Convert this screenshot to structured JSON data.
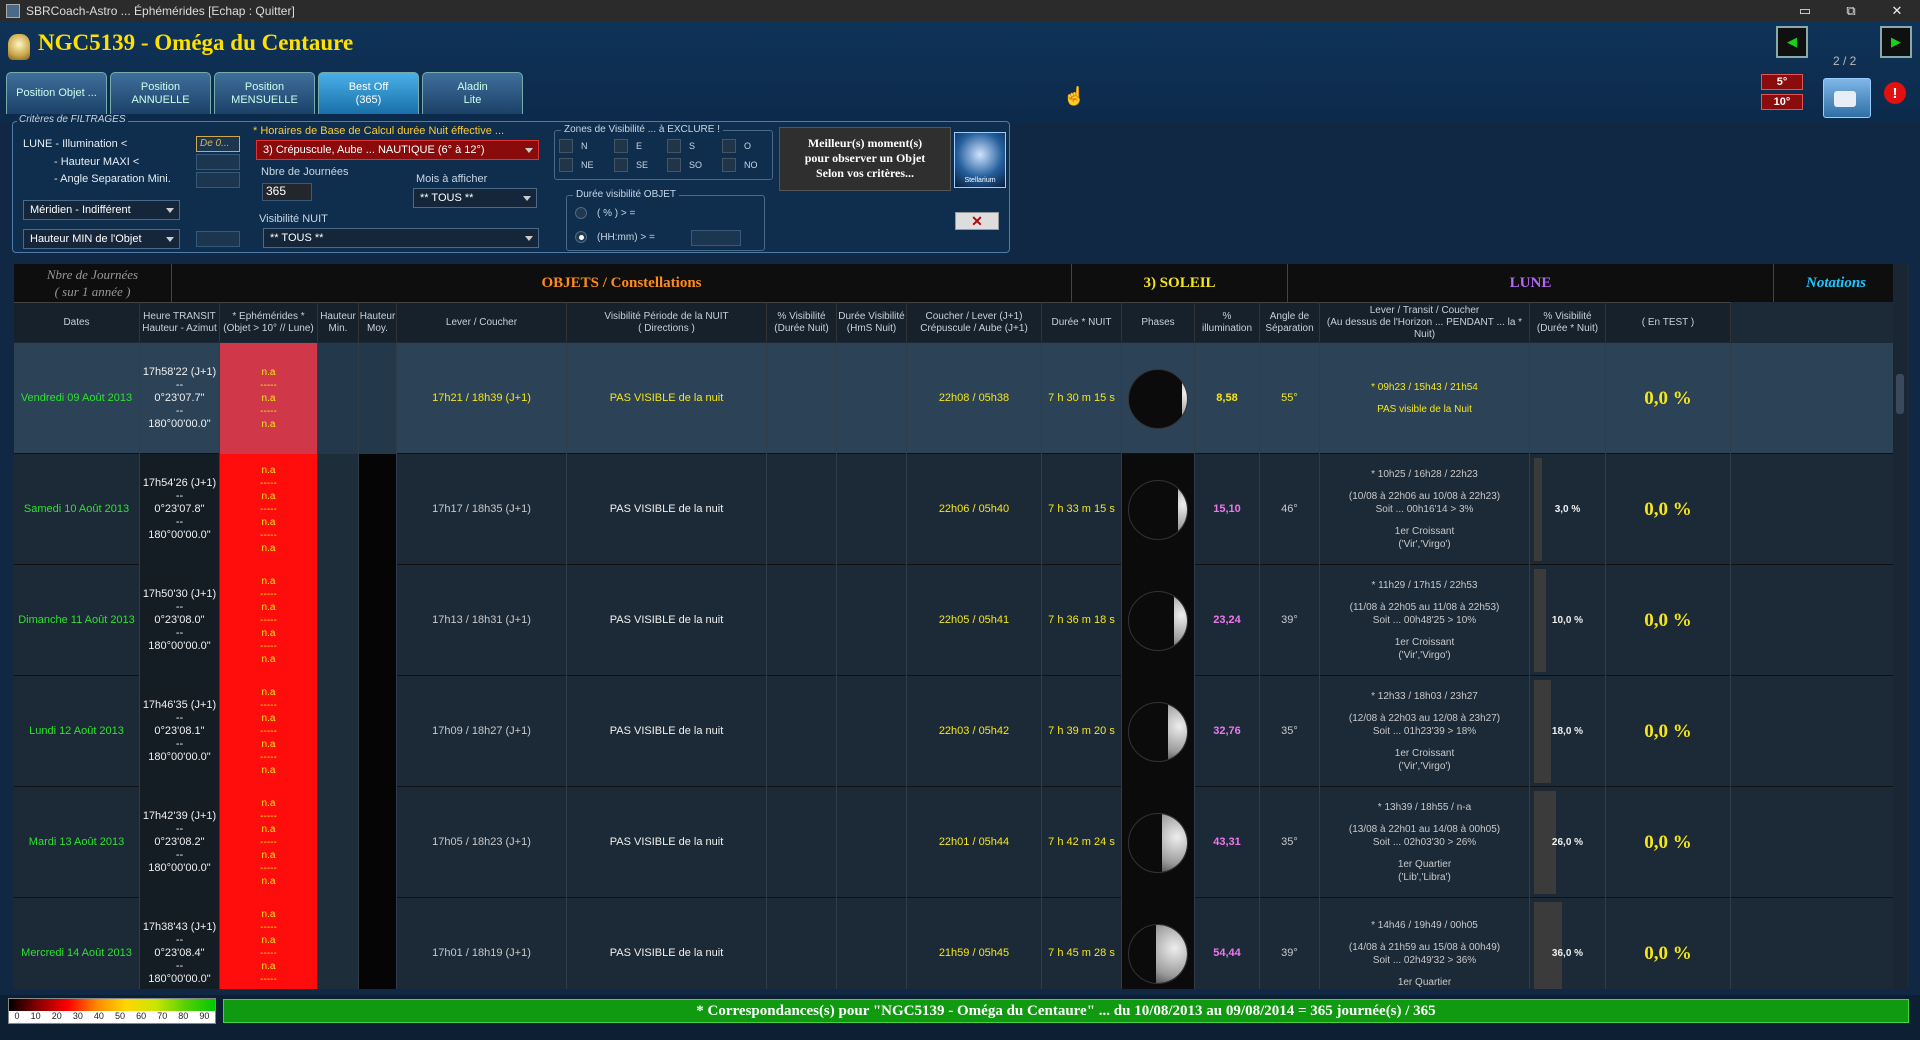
{
  "window": {
    "title": "SBRCoach-Astro ... Éphémérides   [Echap : Quitter]",
    "controls": [
      "▭",
      "⧉",
      "✕"
    ]
  },
  "header": {
    "object_title": "NGC5139 - Oméga du Centaure",
    "prev_arrow": "◀",
    "next_arrow": "▶",
    "page": "2 / 2",
    "deg_options": [
      "5°",
      "10°"
    ],
    "alert": "!"
  },
  "tabs": [
    {
      "line1": "Position Objet ...",
      "line2": "",
      "active": false
    },
    {
      "line1": "Position",
      "line2": "ANNUELLE",
      "active": false
    },
    {
      "line1": "Position",
      "line2": "MENSUELLE",
      "active": false
    },
    {
      "line1": "Best Off",
      "line2": "(365)",
      "active": true
    },
    {
      "line1": "Aladin",
      "line2": "Lite",
      "active": false
    }
  ],
  "filters": {
    "legend": "Critères de FILTRAGES",
    "lune_illum": "LUNE - Illumination <",
    "hauteur_maxi": "- Hauteur MAXI <",
    "angle_sep": "- Angle Separation Mini.",
    "de_placeholder": "De 0...",
    "meridien": "Méridien - Indifférent",
    "hauteur_min": "Hauteur MIN de l'Objet",
    "horaires_label": "* Horaires de Base de Calcul durée Nuit éffective ...",
    "horaires_value": "3) Crépuscule, Aube ... NAUTIQUE (6° à 12°)",
    "nbre_journees_label": "Nbre de Journées",
    "nbre_journees_value": "365",
    "mois_label": "Mois à afficher",
    "mois_value": "** TOUS **",
    "visibilite_label": "Visibilité NUIT",
    "visibilite_value": "** TOUS **",
    "zones_label": "Zones de Visibilité ... à EXCLURE !",
    "zones": [
      "N",
      "E",
      "S",
      "O",
      "NE",
      "SE",
      "SO",
      "NO"
    ],
    "duree_label": "Durée visibilité OBJET",
    "duree_opt1": "( % ) > =",
    "duree_opt2": "(HH:mm) > =",
    "best_btn": [
      "Meilleur(s) moment(s)",
      "pour observer un Objet",
      "Selon vos critères..."
    ],
    "stellarium": "Stellarium",
    "close": "✕"
  },
  "grid": {
    "group_headers": {
      "journees": "Nbre de Journées\n( sur 1 année )",
      "objets": "OBJETS / Constellations",
      "soleil": "3) SOLEIL",
      "lune": "LUNE",
      "notations": "Notations"
    },
    "columns": [
      "Dates",
      "Heure TRANSIT\nHauteur - Azimut",
      "* Ephémérides *\n(Objet > 10° // Lune)",
      "Hauteur\nMin.",
      "Hauteur\nMoy.",
      "Lever / Coucher",
      "Visibilité Période de la NUIT\n( Directions )",
      "% Visibilité\n(Durée Nuit)",
      "Durée Visibilité\n(HmS Nuit)",
      "Coucher / Lever (J+1)\nCrépuscule / Aube (J+1)",
      "Durée * NUIT",
      "Phases",
      "%\nillumination",
      "Angle de\nSéparation",
      "Lever / Transit / Coucher\n(Au dessus de l'Horizon ... PENDANT ... la * Nuit)",
      "% Visibilité\n(Durée * Nuit)",
      "( En TEST )"
    ],
    "rows": [
      {
        "date": "Vendredi 09 Août 2013",
        "transit": [
          "17h58'22 (J+1)",
          "--",
          "0°23'07.7\"",
          "--",
          "180°00'00.0\""
        ],
        "ephem": [
          "n.a",
          "-----",
          "n.a",
          "-----",
          "n.a"
        ],
        "lever_coucher": "17h21 / 18h39 (J+1)",
        "visibilite": "PAS VISIBLE de la nuit",
        "soleil": "22h08 / 05h38",
        "duree_nuit": "7 h 30 m 15 s",
        "phase": 0.08,
        "illum": "8,58",
        "angle": "55°",
        "lune": [
          "* 09h23 / 15h43 / 21h54",
          "",
          "PAS visible de la Nuit"
        ],
        "vis_pct": "",
        "vis_frac": 0,
        "note": "0,0 %"
      },
      {
        "date": "Samedi 10 Août 2013",
        "transit": [
          "17h54'26 (J+1)",
          "--",
          "0°23'07.8\"",
          "--",
          "180°00'00.0\""
        ],
        "ephem": [
          "n.a",
          "-----",
          "n.a",
          "-----",
          "n.a",
          "-----",
          "n.a"
        ],
        "lever_coucher": "17h17 / 18h35 (J+1)",
        "visibilite": "PAS VISIBLE de la nuit",
        "soleil": "22h06 / 05h40",
        "duree_nuit": "7 h 33 m 15 s",
        "phase": 0.15,
        "illum": "15,10",
        "angle": "46°",
        "lune": [
          "* 10h25 / 16h28 / 22h23",
          "",
          "(10/08 à 22h06 au 10/08 à 22h23)",
          "Soit ... 00h16'14 > 3%",
          "",
          "1er Croissant",
          "('Vir','Virgo')"
        ],
        "vis_pct": "3,0 %",
        "vis_frac": 0.03,
        "note": "0,0 %"
      },
      {
        "date": "Dimanche 11 Août 2013",
        "transit": [
          "17h50'30 (J+1)",
          "--",
          "0°23'08.0\"",
          "--",
          "180°00'00.0\""
        ],
        "ephem": [
          "n.a",
          "-----",
          "n.a",
          "-----",
          "n.a",
          "-----",
          "n.a"
        ],
        "lever_coucher": "17h13 / 18h31 (J+1)",
        "visibilite": "PAS VISIBLE de la nuit",
        "soleil": "22h05 / 05h41",
        "duree_nuit": "7 h 36 m 18 s",
        "phase": 0.23,
        "illum": "23,24",
        "angle": "39°",
        "lune": [
          "* 11h29 / 17h15 / 22h53",
          "",
          "(11/08 à 22h05 au 11/08 à 22h53)",
          "Soit ... 00h48'25 > 10%",
          "",
          "1er Croissant",
          "('Vir','Virgo')"
        ],
        "vis_pct": "10,0 %",
        "vis_frac": 0.1,
        "note": "0,0 %"
      },
      {
        "date": "Lundi 12 Août 2013",
        "transit": [
          "17h46'35 (J+1)",
          "--",
          "0°23'08.1\"",
          "--",
          "180°00'00.0\""
        ],
        "ephem": [
          "n.a",
          "-----",
          "n.a",
          "-----",
          "n.a",
          "-----",
          "n.a"
        ],
        "lever_coucher": "17h09 / 18h27 (J+1)",
        "visibilite": "PAS VISIBLE de la nuit",
        "soleil": "22h03 / 05h42",
        "duree_nuit": "7 h 39 m 20 s",
        "phase": 0.33,
        "illum": "32,76",
        "angle": "35°",
        "lune": [
          "* 12h33 / 18h03 / 23h27",
          "",
          "(12/08 à 22h03 au 12/08 à 23h27)",
          "Soit ... 01h23'39 > 18%",
          "",
          "1er Croissant",
          "('Vir','Virgo')"
        ],
        "vis_pct": "18,0 %",
        "vis_frac": 0.18,
        "note": "0,0 %"
      },
      {
        "date": "Mardi 13 Août 2013",
        "transit": [
          "17h42'39 (J+1)",
          "--",
          "0°23'08.2\"",
          "--",
          "180°00'00.0\""
        ],
        "ephem": [
          "n.a",
          "-----",
          "n.a",
          "-----",
          "n.a",
          "-----",
          "n.a"
        ],
        "lever_coucher": "17h05 / 18h23 (J+1)",
        "visibilite": "PAS VISIBLE de la nuit",
        "soleil": "22h01 / 05h44",
        "duree_nuit": "7 h 42 m 24 s",
        "phase": 0.43,
        "illum": "43,31",
        "angle": "35°",
        "lune": [
          "* 13h39 / 18h55 / n-a",
          "",
          "(13/08 à 22h01 au 14/08 à 00h05)",
          "Soit ... 02h03'30 > 26%",
          "",
          "1er Quartier",
          "('Lib','Libra')"
        ],
        "vis_pct": "26,0 %",
        "vis_frac": 0.26,
        "note": "0,0 %"
      },
      {
        "date": "Mercredi 14 Août 2013",
        "transit": [
          "17h38'43 (J+1)",
          "--",
          "0°23'08.4\"",
          "--",
          "180°00'00.0\""
        ],
        "ephem": [
          "n.a",
          "-----",
          "n.a",
          "-----",
          "n.a",
          "-----",
          "n.a"
        ],
        "lever_coucher": "17h01 / 18h19 (J+1)",
        "visibilite": "PAS VISIBLE de la nuit",
        "soleil": "21h59 / 05h45",
        "duree_nuit": "7 h 45 m 28 s",
        "phase": 0.54,
        "illum": "54,44",
        "angle": "39°",
        "lune": [
          "* 14h46 / 19h49 / 00h05",
          "",
          "(14/08 à 21h59 au 15/08 à 00h49)",
          "Soit ... 02h49'32 > 36%",
          "",
          "1er Quartier"
        ],
        "vis_pct": "36,0 %",
        "vis_frac": 0.36,
        "note": "0,0 %"
      }
    ]
  },
  "colorscale": [
    "0",
    "10",
    "20",
    "30",
    "40",
    "50",
    "60",
    "70",
    "80",
    "90"
  ],
  "summary": "* Correspondances(s) pour \"NGC5139 - Oméga du Centaure\"  ... du 10/08/2013 au 09/08/2014 = 365 journée(s) / 365"
}
